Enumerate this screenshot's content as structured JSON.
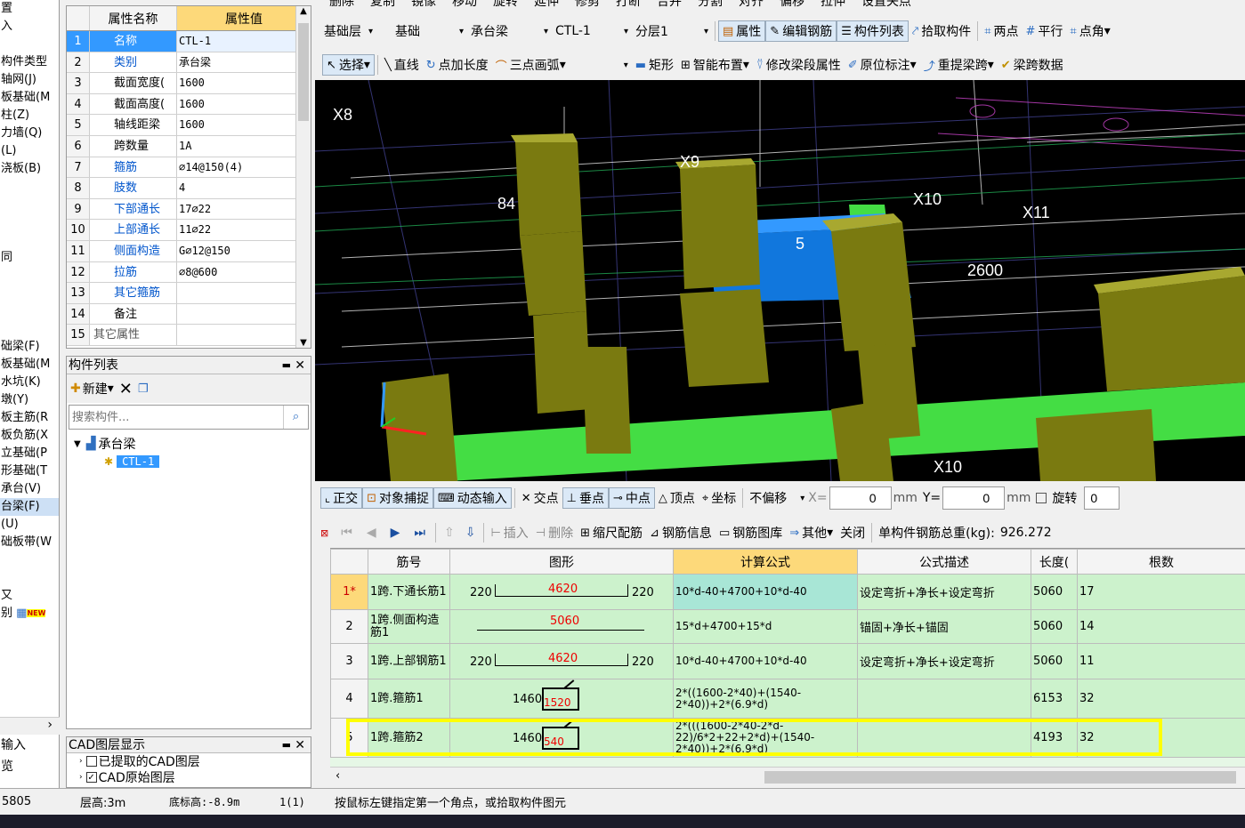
{
  "top_toolbar": {
    "items": [
      "删除",
      "复制",
      "镜像",
      "移动",
      "旋转",
      "延伸",
      "修剪",
      "打断",
      "合并",
      "分割",
      "对齐",
      "偏移",
      "拉伸",
      "设置夹点"
    ]
  },
  "left_nav": {
    "items": [
      "置",
      "入",
      "",
      "构件类型",
      "轴网(J)",
      "板基础(M",
      "柱(Z)",
      "力墙(Q)",
      "(L)",
      "浇板(B)",
      "",
      "",
      "",
      "",
      "同",
      "",
      "",
      "",
      "",
      "础梁(F)",
      "板基础(M",
      "水坑(K)",
      "墩(Y)",
      "板主筋(R",
      "板负筋(X",
      "立基础(P",
      "形基础(T",
      "承台(V)",
      "台梁(F)",
      "(U)",
      "础板带(W",
      "",
      "",
      "又",
      "别"
    ],
    "selected_index": 28,
    "new_badge": "NEW",
    "bottom_items": [
      "输入",
      "览"
    ]
  },
  "property_grid": {
    "col_name": "属性名称",
    "col_value": "属性值",
    "rows": [
      {
        "n": "1",
        "k": "名称",
        "v": "CTL-1"
      },
      {
        "n": "2",
        "k": "类别",
        "v": "承台梁"
      },
      {
        "n": "3",
        "k": "截面宽度(",
        "v": "1600"
      },
      {
        "n": "4",
        "k": "截面高度(",
        "v": "1600"
      },
      {
        "n": "5",
        "k": "轴线距梁",
        "v": "1600"
      },
      {
        "n": "6",
        "k": "跨数量",
        "v": "1A"
      },
      {
        "n": "7",
        "k": "箍筋",
        "v": "⌀14@150(4)"
      },
      {
        "n": "8",
        "k": "肢数",
        "v": "4"
      },
      {
        "n": "9",
        "k": "下部通长",
        "v": "17⌀22"
      },
      {
        "n": "10",
        "k": "上部通长",
        "v": "11⌀22"
      },
      {
        "n": "11",
        "k": "侧面构造",
        "v": "G⌀12@150"
      },
      {
        "n": "12",
        "k": "拉筋",
        "v": "⌀8@600"
      },
      {
        "n": "13",
        "k": "其它箍筋",
        "v": ""
      },
      {
        "n": "14",
        "k": "备注",
        "v": ""
      },
      {
        "n": "15",
        "k": "其它属性",
        "v": ""
      }
    ]
  },
  "component_list": {
    "title": "构件列表",
    "new_label": "新建",
    "search_placeholder": "搜索构件...",
    "tree_root": "承台梁",
    "tree_child": "CTL-1"
  },
  "cad_layers": {
    "title": "CAD图层显示",
    "items": [
      "已提取的CAD图层",
      "CAD原始图层"
    ]
  },
  "selectors": {
    "layer": "基础层",
    "category": "基础",
    "type": "承台梁",
    "component": "CTL-1",
    "sublayer": "分层1"
  },
  "main_toolbar": {
    "property": "属性",
    "edit_rebar": "编辑钢筋",
    "comp_list": "构件列表",
    "pick": "拾取构件",
    "two_points": "两点",
    "parallel": "平行",
    "point_angle": "点角"
  },
  "draw_toolbar": {
    "select": "选择",
    "line": "直线",
    "point_len": "点加长度",
    "arc": "三点画弧",
    "rect": "矩形",
    "smart": "智能布置",
    "modify_seg": "修改梁段属性",
    "orig_mark": "原位标注",
    "re_span": "重提梁跨",
    "span_data": "梁跨数据"
  },
  "viewport": {
    "labels": [
      "X8",
      "X9",
      "X10",
      "X11",
      "X10",
      "2600",
      "84",
      "5"
    ]
  },
  "snap_toolbar": {
    "ortho": "正交",
    "obj_snap": "对象捕捉",
    "dyn_input": "动态输入",
    "intersect": "交点",
    "perp": "垂点",
    "mid": "中点",
    "vertex": "顶点",
    "coord": "坐标",
    "offset_mode": "不偏移",
    "x_label": "X=",
    "x_value": "0",
    "y_label": "Y=",
    "y_value": "0",
    "unit": "mm",
    "rotate_label": "旋转",
    "rotate_value": "0"
  },
  "rebar_toolbar": {
    "insert": "插入",
    "delete": "删除",
    "scale": "缩尺配筋",
    "info": "钢筋信息",
    "lib": "钢筋图库",
    "other": "其他",
    "close": "关闭",
    "total_label": "单构件钢筋总重(kg):",
    "total_value": "926.272"
  },
  "rebar_table": {
    "headers": [
      "筋号",
      "图形",
      "计算公式",
      "公式描述",
      "长度(",
      "根数"
    ],
    "rows": [
      {
        "n": "1*",
        "name": "1跨.下通长筋1",
        "fig_left": "220",
        "fig_mid": "4620",
        "fig_right": "220",
        "fig_type": "u",
        "formula": "10*d-40+4700+10*d-40",
        "desc": "设定弯折+净长+设定弯折",
        "len": "5060",
        "count": "17"
      },
      {
        "n": "2",
        "name": "1跨.侧面构造筋1",
        "fig_left": "",
        "fig_mid": "5060",
        "fig_right": "",
        "fig_type": "line",
        "formula": "15*d+4700+15*d",
        "desc": "锚固+净长+锚固",
        "len": "5060",
        "count": "14"
      },
      {
        "n": "3",
        "name": "1跨.上部钢筋1",
        "fig_left": "220",
        "fig_mid": "4620",
        "fig_right": "220",
        "fig_type": "u",
        "formula": "10*d-40+4700+10*d-40",
        "desc": "设定弯折+净长+设定弯折",
        "len": "5060",
        "count": "11"
      },
      {
        "n": "4",
        "name": "1跨.箍筋1",
        "fig_left": "1460",
        "fig_mid": "1520",
        "fig_right": "",
        "fig_type": "stirrup",
        "formula": "2*((1600-2*40)+(1540-2*40))+2*(6.9*d)",
        "desc": "",
        "len": "6153",
        "count": "32"
      },
      {
        "n": "5",
        "name": "1跨.箍筋2",
        "fig_left": "1460",
        "fig_mid": "540",
        "fig_right": "",
        "fig_type": "stirrup",
        "formula": "2*(((1600-2*40-2*d-22)/6*2+22+2*d)+(1540-2*40))+2*(6.9*d)",
        "desc": "",
        "len": "4193",
        "count": "32"
      }
    ]
  },
  "status_bar": {
    "coord": "5805",
    "floor_height": "层高:3m",
    "bottom_elev": "底标高:-8.9m",
    "count": "1(1)",
    "hint": "按鼠标左键指定第一个角点，或拾取构件图元"
  },
  "colors": {
    "highlight_yellow": "#ffff00",
    "header_orange": "#fdd97a",
    "row_green": "#ccf2cc",
    "selected_blue": "#3399ff"
  }
}
